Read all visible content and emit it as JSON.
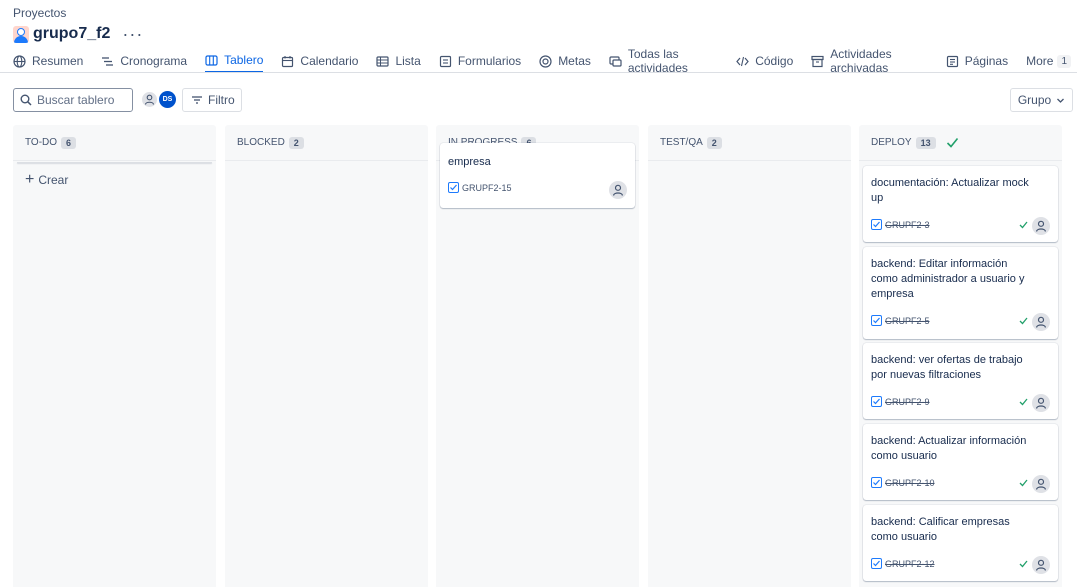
{
  "breadcrumb": "Proyectos",
  "project": {
    "title": "grupo7_f2"
  },
  "tabs": [
    {
      "label": "Resumen",
      "icon": "globe-icon"
    },
    {
      "label": "Cronograma",
      "icon": "timeline-icon"
    },
    {
      "label": "Tablero",
      "icon": "board-icon",
      "active": true
    },
    {
      "label": "Calendario",
      "icon": "calendar-icon"
    },
    {
      "label": "Lista",
      "icon": "list-icon"
    },
    {
      "label": "Formularios",
      "icon": "forms-icon"
    },
    {
      "label": "Metas",
      "icon": "target-icon"
    },
    {
      "label": "Todas las actividades",
      "icon": "activities-icon"
    },
    {
      "label": "Código",
      "icon": "code-icon"
    },
    {
      "label": "Actividades archivadas",
      "icon": "archive-icon"
    },
    {
      "label": "Páginas",
      "icon": "page-icon"
    }
  ],
  "more_tab": {
    "label": "More",
    "count": "1"
  },
  "toolbar": {
    "search_placeholder": "Buscar tablero",
    "avatar_ds": "DS",
    "filter_label": "Filtro",
    "group_label": "Grupo"
  },
  "columns": [
    {
      "name": "TO-DO",
      "count": "6",
      "create_label": "Crear"
    },
    {
      "name": "BLOCKED",
      "count": "2"
    },
    {
      "name": "IN PROGRESS",
      "count": "6"
    },
    {
      "name": "TEST/QA",
      "count": "2"
    },
    {
      "name": "DEPLOY",
      "count": "13"
    }
  ],
  "in_progress_cards": [
    {
      "text": "empresa",
      "key": "GRUPF2-15"
    }
  ],
  "deploy_cards": [
    {
      "text": "documentación: Actualizar mock up",
      "key": "GRUPF2-3"
    },
    {
      "text": "backend: Editar información como administrador a usuario y empresa",
      "key": "GRUPF2-5"
    },
    {
      "text": "backend: ver ofertas de trabajo por nuevas filtraciones",
      "key": "GRUPF2-9"
    },
    {
      "text": "backend: Actualizar información como usuario",
      "key": "GRUPF2-10"
    },
    {
      "text": "backend: Calificar empresas como usuario",
      "key": "GRUPF2-12"
    }
  ],
  "colors": {
    "accent": "#0c66e4",
    "done_check": "#22a06b",
    "column_bg": "#f7f8f9"
  }
}
